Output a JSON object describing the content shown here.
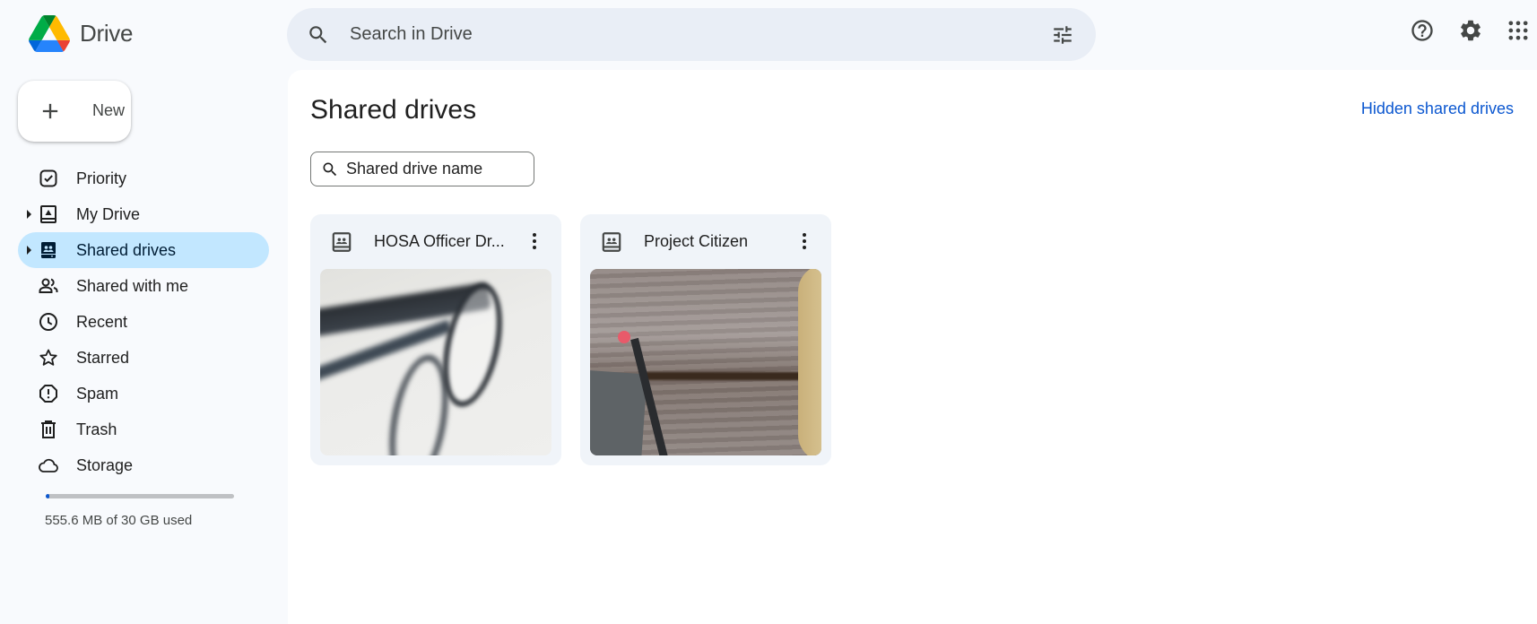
{
  "app": {
    "name": "Drive",
    "brand_colors": {
      "blue": "#4285f4",
      "green": "#34a853",
      "yellow": "#fbbc04",
      "red": "#ea4335"
    }
  },
  "header": {
    "search_placeholder": "Search in Drive",
    "search_value": "",
    "icons": {
      "search": "search-icon",
      "filters": "tune-icon",
      "help": "help-icon",
      "settings": "gear-icon",
      "apps": "apps-grid-icon"
    }
  },
  "sidebar": {
    "new_label": "New",
    "items": [
      {
        "label": "Priority",
        "icon": "priority-check-icon",
        "expandable": false,
        "active": false
      },
      {
        "label": "My Drive",
        "icon": "my-drive-icon",
        "expandable": true,
        "active": false
      },
      {
        "label": "Shared drives",
        "icon": "shared-drives-icon",
        "expandable": true,
        "active": true
      },
      {
        "label": "Shared with me",
        "icon": "people-icon",
        "expandable": false,
        "active": false
      },
      {
        "label": "Recent",
        "icon": "clock-icon",
        "expandable": false,
        "active": false
      },
      {
        "label": "Starred",
        "icon": "star-icon",
        "expandable": false,
        "active": false
      },
      {
        "label": "Spam",
        "icon": "spam-icon",
        "expandable": false,
        "active": false
      },
      {
        "label": "Trash",
        "icon": "trash-icon",
        "expandable": false,
        "active": false
      },
      {
        "label": "Storage",
        "icon": "cloud-icon",
        "expandable": false,
        "active": false
      }
    ],
    "storage": {
      "used_text": "555.6 MB of 30 GB used",
      "used_fraction": 0.018,
      "bar_color": "#0b57d0"
    }
  },
  "main": {
    "title": "Shared drives",
    "hidden_link": "Hidden shared drives",
    "filter_placeholder": "Shared drive name",
    "filter_value": "",
    "drives": [
      {
        "name": "HOSA Officer Dr...",
        "thumbnail": "blurry eyeglasses on white surface"
      },
      {
        "name": "Project Citizen",
        "thumbnail": "wooden table with pencil, notebook and coffee cup"
      }
    ]
  },
  "colors": {
    "background": "#f8fafd",
    "search_bg": "#e9eef6",
    "active_nav": "#c2e7ff",
    "card_bg": "#f0f4f9",
    "link": "#0b57d0"
  }
}
